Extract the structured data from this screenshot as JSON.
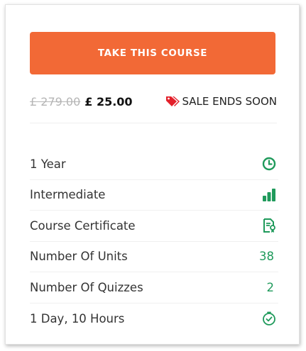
{
  "course": {
    "cta_label": "TAKE THIS COURSE",
    "old_price": "£ 279.00",
    "new_price": "£ 25.00",
    "sale_text": "SALE ENDS SOON",
    "tag_icon": "price-tag-icon",
    "colors": {
      "button": "#f26936",
      "accent_green": "#1f9a5b",
      "tag_red": "#e3202a",
      "old_price": "#b5b5b5"
    }
  },
  "details": [
    {
      "label": "1 Year",
      "icon": "clock-icon"
    },
    {
      "label": "Intermediate",
      "icon": "level-bars-icon"
    },
    {
      "label": "Course Certificate",
      "icon": "certificate-icon"
    },
    {
      "label": "Number Of Units",
      "value": "38"
    },
    {
      "label": "Number Of Quizzes",
      "value": "2"
    },
    {
      "label": "1 Day, 10 Hours",
      "icon": "stopwatch-icon"
    }
  ]
}
